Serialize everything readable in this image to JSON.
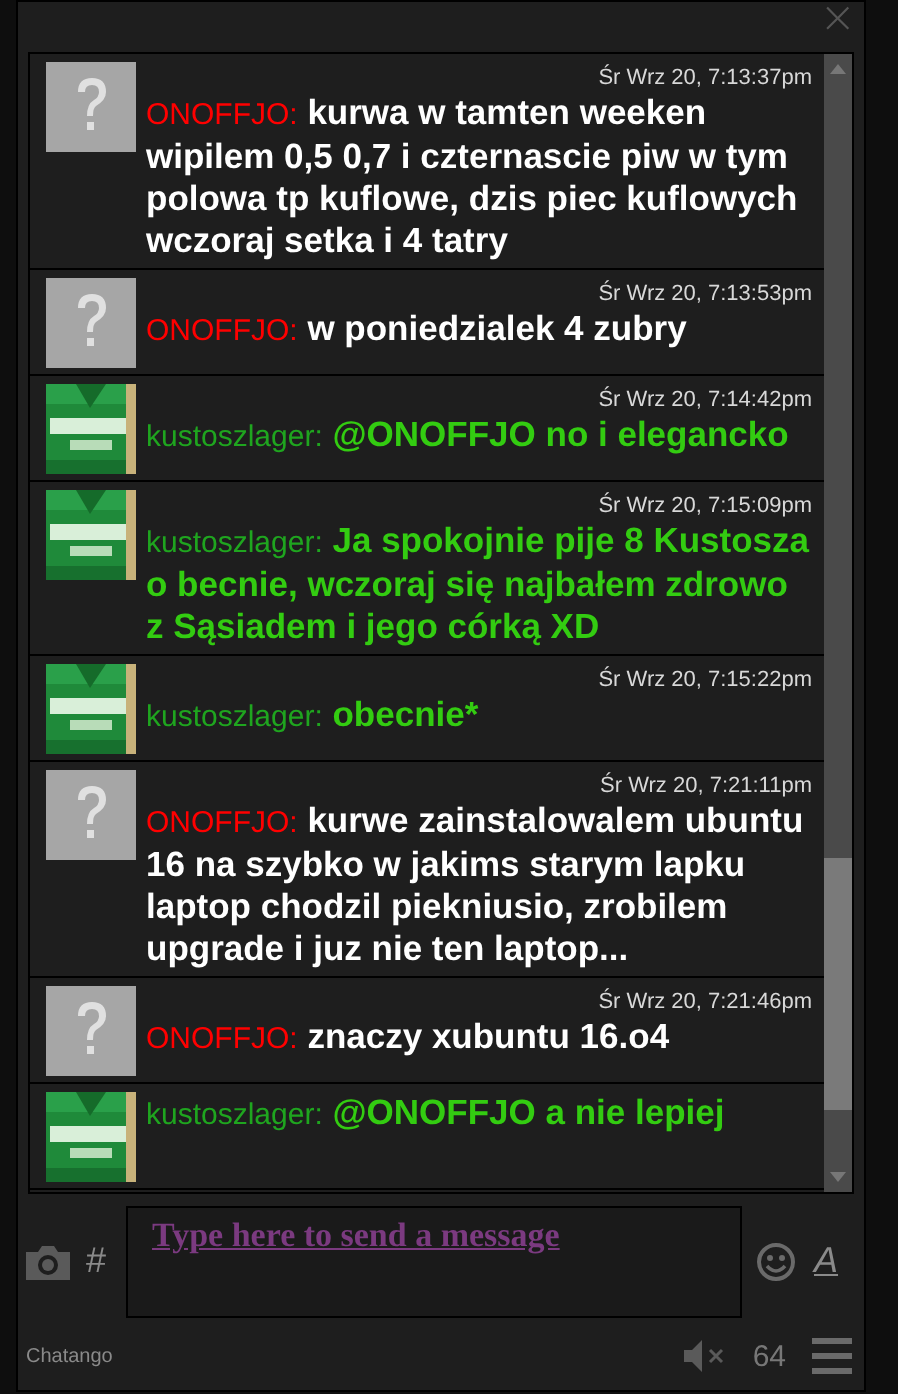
{
  "window": {
    "close": "×"
  },
  "messages": [
    {
      "kind": "unknown",
      "time": "Śr Wrz 20, 7:13:37pm",
      "author": {
        "name": "ONOFFJO:",
        "color": "#ff0000"
      },
      "body": {
        "text": "kurwa w tamten weeken wipilem 0,5 0,7 i czternascie piw w tym polowa tp kuflowe, dzis piec kuflowych wczoraj setka i 4 tatry",
        "color": "#ffffff"
      }
    },
    {
      "kind": "unknown",
      "time": "Śr Wrz 20, 7:13:53pm",
      "author": {
        "name": "ONOFFJO:",
        "color": "#ff0000"
      },
      "body": {
        "text": "w poniedzialek 4 zubry",
        "color": "#ffffff"
      }
    },
    {
      "kind": "picture",
      "time": "Śr Wrz 20, 7:14:42pm",
      "author": {
        "name": "kustoszlager:",
        "color": "#1fa51f"
      },
      "body": {
        "text": "@ONOFFJO no i elegancko",
        "color": "#33cc11"
      }
    },
    {
      "kind": "picture",
      "time": "Śr Wrz 20, 7:15:09pm",
      "author": {
        "name": "kustoszlager:",
        "color": "#1fa51f"
      },
      "body": {
        "text": "Ja spokojnie pije 8 Kustosza o becnie, wczoraj się najbałem zdrowo z Sąsiadem i jego córką XD",
        "color": "#33cc11"
      }
    },
    {
      "kind": "picture",
      "time": "Śr Wrz 20, 7:15:22pm",
      "author": {
        "name": "kustoszlager:",
        "color": "#1fa51f"
      },
      "body": {
        "text": "obecnie*",
        "color": "#33cc11"
      }
    },
    {
      "kind": "unknown",
      "time": "Śr Wrz 20, 7:21:11pm",
      "author": {
        "name": "ONOFFJO:",
        "color": "#ff0000"
      },
      "body": {
        "text": "kurwe zainstalowalem ubuntu 16 na szybko w jakims starym lapku laptop chodzil piekniusio, zrobilem upgrade i juz nie ten laptop...",
        "color": "#ffffff"
      }
    },
    {
      "kind": "unknown",
      "time": "Śr Wrz 20, 7:21:46pm",
      "author": {
        "name": "ONOFFJO:",
        "color": "#ff0000"
      },
      "body": {
        "text": "znaczy xubuntu 16.o4",
        "color": "#ffffff"
      }
    },
    {
      "kind": "picture",
      "author": {
        "name": "kustoszlager:",
        "color": "#1fa51f"
      },
      "body": {
        "text": "@ONOFFJO a nie lepiej",
        "color": "#33cc11"
      }
    }
  ],
  "input": {
    "hash": "#",
    "placeholder": "Type here to send a message",
    "format": "A"
  },
  "footer": {
    "brand": "Chatango",
    "count": "64"
  }
}
